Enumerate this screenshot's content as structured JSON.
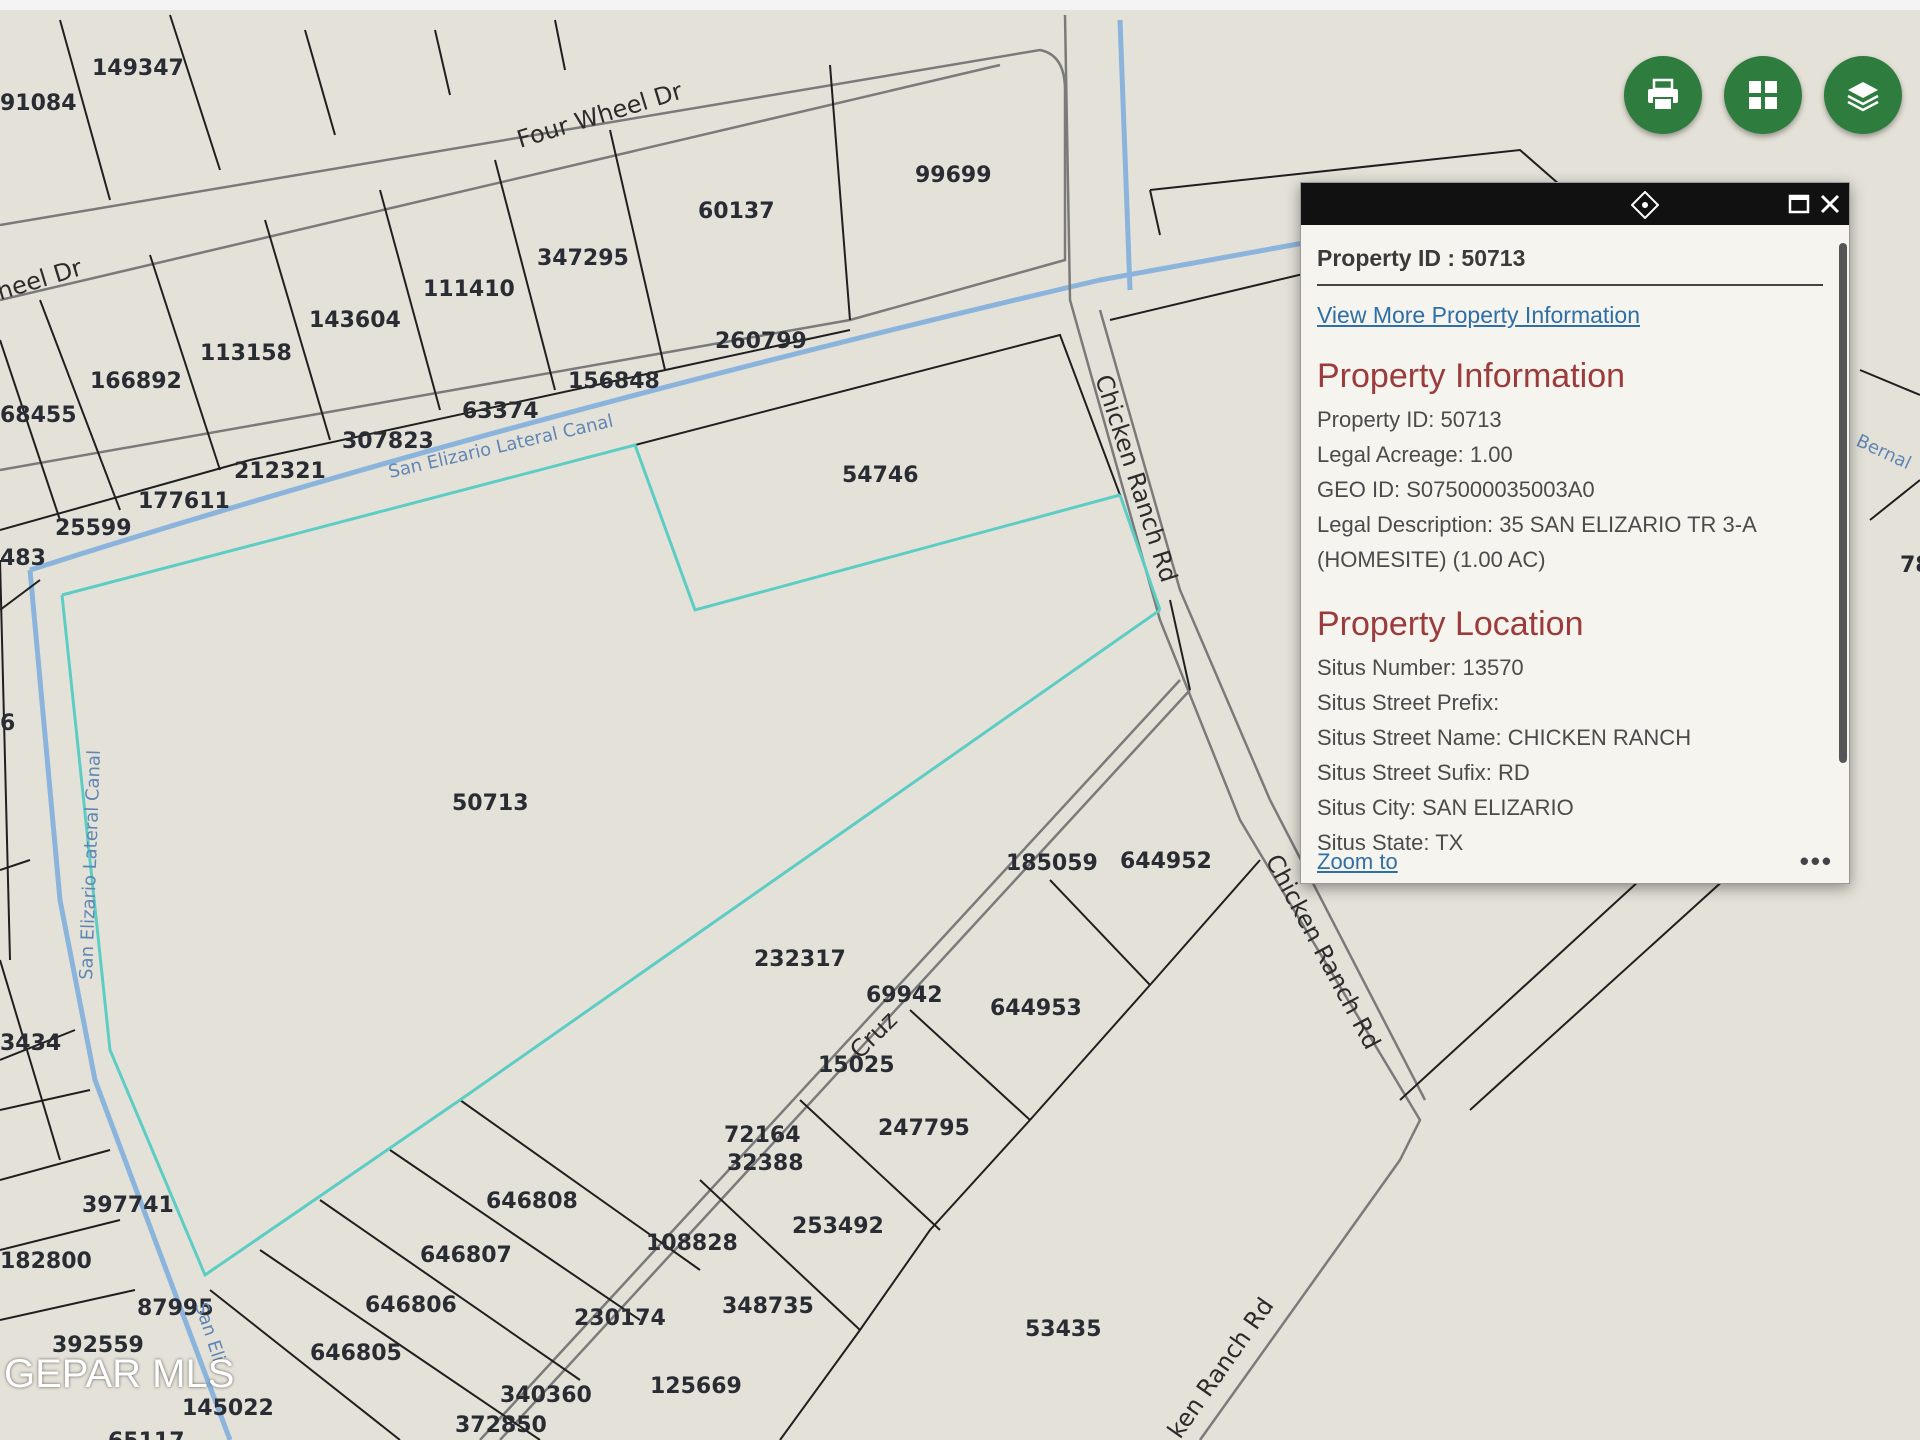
{
  "map": {
    "parcels": [
      {
        "id": "149347"
      },
      {
        "id": "91084"
      },
      {
        "id": "99699"
      },
      {
        "id": "60137"
      },
      {
        "id": "347295"
      },
      {
        "id": "111410"
      },
      {
        "id": "143604"
      },
      {
        "id": "113158"
      },
      {
        "id": "166892"
      },
      {
        "id": "68455"
      },
      {
        "id": "260799"
      },
      {
        "id": "156848"
      },
      {
        "id": "63374"
      },
      {
        "id": "307823"
      },
      {
        "id": "212321"
      },
      {
        "id": "177611"
      },
      {
        "id": "25599"
      },
      {
        "id": "483"
      },
      {
        "id": "54746"
      },
      {
        "id": "50713"
      },
      {
        "id": "6"
      },
      {
        "id": "3434"
      },
      {
        "id": "185059"
      },
      {
        "id": "644952"
      },
      {
        "id": "232317"
      },
      {
        "id": "69942"
      },
      {
        "id": "644953"
      },
      {
        "id": "15025"
      },
      {
        "id": "72164"
      },
      {
        "id": "32388"
      },
      {
        "id": "247795"
      },
      {
        "id": "646808"
      },
      {
        "id": "397741"
      },
      {
        "id": "182800"
      },
      {
        "id": "253492"
      },
      {
        "id": "108828"
      },
      {
        "id": "646807"
      },
      {
        "id": "87995"
      },
      {
        "id": "646806"
      },
      {
        "id": "230174"
      },
      {
        "id": "348735"
      },
      {
        "id": "392559"
      },
      {
        "id": "646805"
      },
      {
        "id": "53435"
      },
      {
        "id": "145022"
      },
      {
        "id": "340360"
      },
      {
        "id": "125669"
      },
      {
        "id": "372850"
      },
      {
        "id": "65117"
      },
      {
        "id": "78"
      }
    ],
    "roads": {
      "four_wheel_dr": "Four Wheel Dr",
      "wheel_dr_partial": "heel Dr",
      "chicken_ranch_1": "Chicken Ranch Rd",
      "chicken_ranch_2": "Chicken Ranch Rd",
      "chicken_ranch_3": "ken Ranch Rd",
      "cruz_partial": "Cruz",
      "bernal_partial": "Bernal"
    },
    "canals": {
      "north": "San Elizario Lateral Canal",
      "west": "San Elizario Lateral Canal",
      "southwest": "San Eli"
    },
    "colors": {
      "selected_parcel": "#5ccdc4",
      "canal": "#8bb4dc",
      "parcel_line": "#1f1f1f"
    }
  },
  "toolbar": {
    "print": {
      "icon": "printer-icon"
    },
    "basemap": {
      "icon": "grid-icon"
    },
    "layers": {
      "icon": "layers-icon"
    },
    "accent": "#2f7d3e"
  },
  "popup": {
    "title": "Property ID : 50713",
    "link": "View More Property Information",
    "property_info": {
      "heading": "Property Information",
      "fields": [
        "Property ID: 50713",
        "Legal Acreage: 1.00",
        "GEO ID: S075000035003A0",
        "Legal Description: 35 SAN ELIZARIO TR 3-A",
        "(HOMESITE) (1.00 AC)"
      ]
    },
    "location": {
      "heading": "Property Location",
      "fields": [
        "Situs Number: 13570",
        "Situs Street Prefix:",
        "Situs Street Name: CHICKEN RANCH",
        "Situs Street Sufix: RD",
        "Situs City: SAN ELIZARIO",
        "Situs State: TX"
      ]
    },
    "zoom_to": "Zoom to",
    "more": "•••"
  },
  "watermark": "GEPAR MLS"
}
